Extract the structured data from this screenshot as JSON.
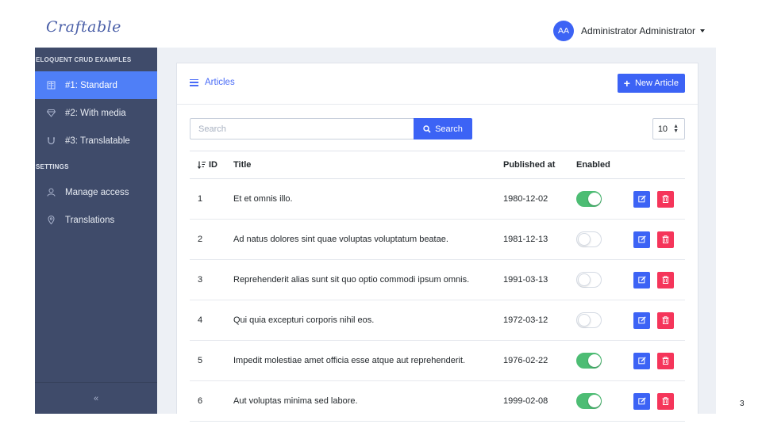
{
  "header": {
    "brand": "Craftable",
    "avatar_initials": "AA",
    "user_name": "Administrator Administrator"
  },
  "sidebar": {
    "section1_title": "ELOQUENT CRUD EXAMPLES",
    "items": [
      {
        "label": "#1: Standard",
        "icon": "book-icon",
        "active": true
      },
      {
        "label": "#2: With media",
        "icon": "diamond-icon",
        "active": false
      },
      {
        "label": "#3: Translatable",
        "icon": "magnet-icon",
        "active": false
      }
    ],
    "section2_title": "SETTINGS",
    "settings_items": [
      {
        "label": "Manage access",
        "icon": "user-icon"
      },
      {
        "label": "Translations",
        "icon": "location-pin-icon"
      }
    ],
    "collapse_label": "«"
  },
  "card": {
    "title": "Articles",
    "new_button": "New Article",
    "search_placeholder": "Search",
    "search_button": "Search",
    "per_page": "10"
  },
  "table": {
    "columns": {
      "id": "ID",
      "title": "Title",
      "published_at": "Published at",
      "enabled": "Enabled"
    },
    "rows": [
      {
        "id": "1",
        "title": "Et et omnis illo.",
        "published_at": "1980-12-02",
        "enabled": true
      },
      {
        "id": "2",
        "title": "Ad natus dolores sint quae voluptas voluptatum beatae.",
        "published_at": "1981-12-13",
        "enabled": false
      },
      {
        "id": "3",
        "title": "Reprehenderit alias sunt sit quo optio commodi ipsum omnis.",
        "published_at": "1991-03-13",
        "enabled": false
      },
      {
        "id": "4",
        "title": "Qui quia excepturi corporis nihil eos.",
        "published_at": "1972-03-12",
        "enabled": false
      },
      {
        "id": "5",
        "title": "Impedit molestiae amet officia esse atque aut reprehenderit.",
        "published_at": "1976-02-22",
        "enabled": true
      },
      {
        "id": "6",
        "title": "Aut voluptas minima sed labore.",
        "published_at": "1999-02-08",
        "enabled": true
      }
    ]
  },
  "page_number": "3",
  "colors": {
    "primary": "#3c63f5",
    "sidebar": "#3f4b6a",
    "sidebar_active": "#4f7ff7",
    "danger": "#f5355a",
    "success": "#4dbd74"
  }
}
